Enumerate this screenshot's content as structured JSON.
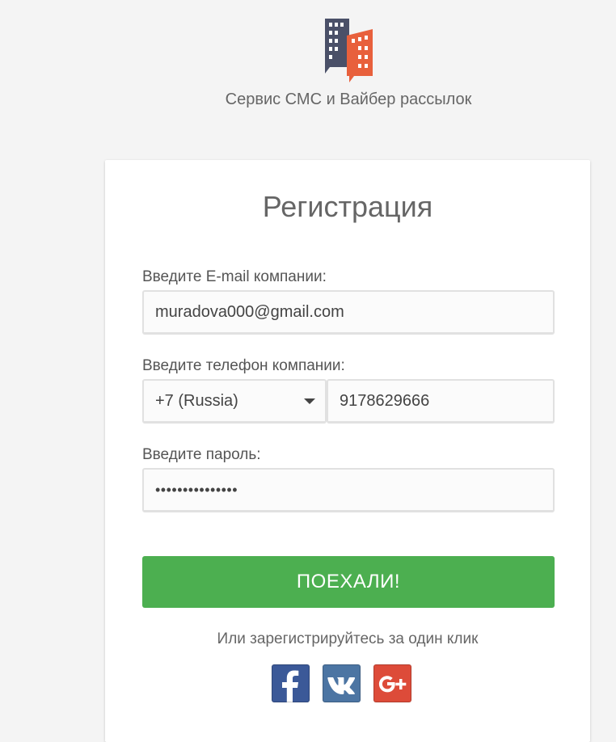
{
  "header": {
    "tagline": "Сервис СМС и Вайбер рассылок",
    "logo_icon": "buildings-logo-icon"
  },
  "form": {
    "title": "Регистрация",
    "email_label": "Введите E-mail компании:",
    "email_value": "muradova000@gmail.com",
    "phone_label": "Введите телефон компании:",
    "country_selected": "+7 (Russia)",
    "phone_value": "9178629666",
    "password_label": "Введите пароль:",
    "password_value": "•••••••••••••••",
    "submit_label": "ПОЕХАЛИ!",
    "social_prompt": "Или зарегистрируйтесь за один клик"
  },
  "social": {
    "facebook_icon": "facebook-icon",
    "vk_icon": "vk-icon",
    "google_plus_icon": "google-plus-icon"
  },
  "colors": {
    "background": "#f4f4f4",
    "card": "#ffffff",
    "primary": "#4caf50",
    "logo_dark": "#4a5068",
    "logo_accent": "#e8603c",
    "facebook": "#3b5998",
    "vk": "#4c75a3",
    "google_plus": "#dd4b39"
  }
}
